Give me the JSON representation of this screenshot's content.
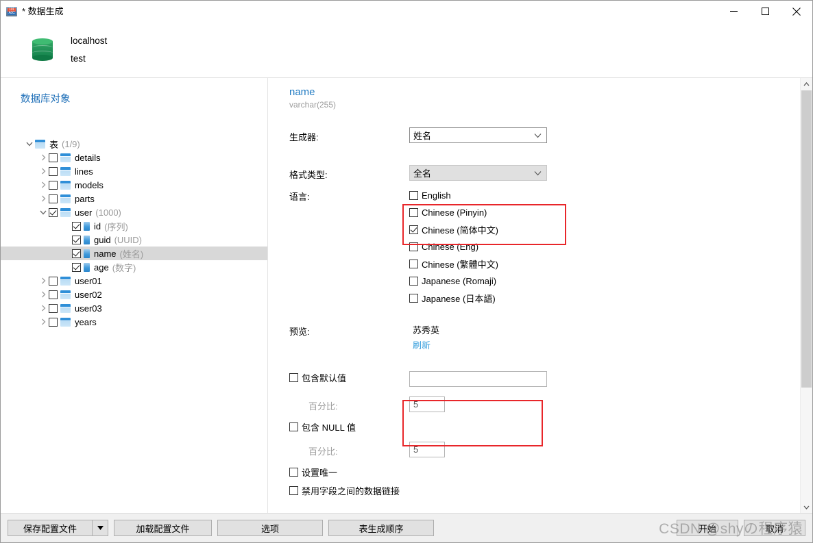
{
  "window": {
    "title": "* 数据生成",
    "title_icon": "data-generation-icon",
    "minimize_label": "—",
    "maximize_label": "□",
    "close_label": "✕"
  },
  "connection": {
    "icon": "database-icon",
    "host": "localhost",
    "database": "test"
  },
  "left_pane": {
    "title": "数据库对象",
    "tree": [
      {
        "level": 0,
        "twisty": "expanded",
        "checkbox": "none",
        "icon": "table-group-icon",
        "name": "表",
        "meta": "(1/9)",
        "selected": false
      },
      {
        "level": 1,
        "twisty": "collapsed",
        "checkbox": "unchecked",
        "icon": "table-icon",
        "name": "details",
        "meta": "",
        "selected": false
      },
      {
        "level": 1,
        "twisty": "collapsed",
        "checkbox": "unchecked",
        "icon": "table-icon",
        "name": "lines",
        "meta": "",
        "selected": false
      },
      {
        "level": 1,
        "twisty": "collapsed",
        "checkbox": "unchecked",
        "icon": "table-icon",
        "name": "models",
        "meta": "",
        "selected": false
      },
      {
        "level": 1,
        "twisty": "collapsed",
        "checkbox": "unchecked",
        "icon": "table-icon",
        "name": "parts",
        "meta": "",
        "selected": false
      },
      {
        "level": 1,
        "twisty": "expanded",
        "checkbox": "checked",
        "icon": "table-icon",
        "name": "user",
        "meta": "(1000)",
        "selected": false
      },
      {
        "level": 2,
        "twisty": "none",
        "checkbox": "checked",
        "icon": "column-icon",
        "name": "id",
        "meta": "(序列)",
        "selected": false
      },
      {
        "level": 2,
        "twisty": "none",
        "checkbox": "checked",
        "icon": "column-icon",
        "name": "guid",
        "meta": "(UUID)",
        "selected": false
      },
      {
        "level": 2,
        "twisty": "none",
        "checkbox": "checked",
        "icon": "column-icon",
        "name": "name",
        "meta": "(姓名)",
        "selected": true
      },
      {
        "level": 2,
        "twisty": "none",
        "checkbox": "checked",
        "icon": "column-icon",
        "name": "age",
        "meta": "(数字)",
        "selected": false
      },
      {
        "level": 1,
        "twisty": "collapsed",
        "checkbox": "unchecked",
        "icon": "table-icon",
        "name": "user01",
        "meta": "",
        "selected": false
      },
      {
        "level": 1,
        "twisty": "collapsed",
        "checkbox": "unchecked",
        "icon": "table-icon",
        "name": "user02",
        "meta": "",
        "selected": false
      },
      {
        "level": 1,
        "twisty": "collapsed",
        "checkbox": "unchecked",
        "icon": "table-icon",
        "name": "user03",
        "meta": "",
        "selected": false
      },
      {
        "level": 1,
        "twisty": "collapsed",
        "checkbox": "unchecked",
        "icon": "table-icon",
        "name": "years",
        "meta": "",
        "selected": false
      }
    ]
  },
  "field": {
    "name": "name",
    "type": "varchar(255)"
  },
  "form": {
    "generator_label": "生成器:",
    "generator_value": "姓名",
    "format_label": "格式类型:",
    "format_value": "全名",
    "language_label": "语言:",
    "languages": [
      {
        "label": "English",
        "checked": false
      },
      {
        "label": "Chinese (Pinyin)",
        "checked": false
      },
      {
        "label": "Chinese (简体中文)",
        "checked": true
      },
      {
        "label": "Chinese (Eng)",
        "checked": false
      },
      {
        "label": "Chinese (繁體中文)",
        "checked": false
      },
      {
        "label": "Japanese (Romaji)",
        "checked": false
      },
      {
        "label": "Japanese (日本語)",
        "checked": false
      }
    ],
    "preview_label": "预览:",
    "preview_value": "苏秀英",
    "preview_refresh": "刷新",
    "include_default_label": "包含默认值",
    "include_default_checked": false,
    "include_default_value": "",
    "default_percent_label": "百分比:",
    "default_percent_value": "5",
    "include_null_label": "包含 NULL 值",
    "include_null_checked": false,
    "null_percent_label": "百分比:",
    "null_percent_value": "5",
    "unique_label": "设置唯一",
    "unique_checked": false,
    "disable_link_label": "禁用字段之间的数据链接",
    "disable_link_checked": false
  },
  "footer": {
    "save_profile": "保存配置文件",
    "load_profile": "加载配置文件",
    "options": "选项",
    "table_order": "表生成顺序",
    "start": "开始",
    "cancel": "取消"
  },
  "watermark": "CSDN @shyの程序猿",
  "colors": {
    "accent_blue": "#1e6fb8",
    "link_blue": "#3aa0dd",
    "highlight_red": "#e8262a",
    "selection_gray": "#d8d8d8",
    "db_green": "#25955a"
  }
}
